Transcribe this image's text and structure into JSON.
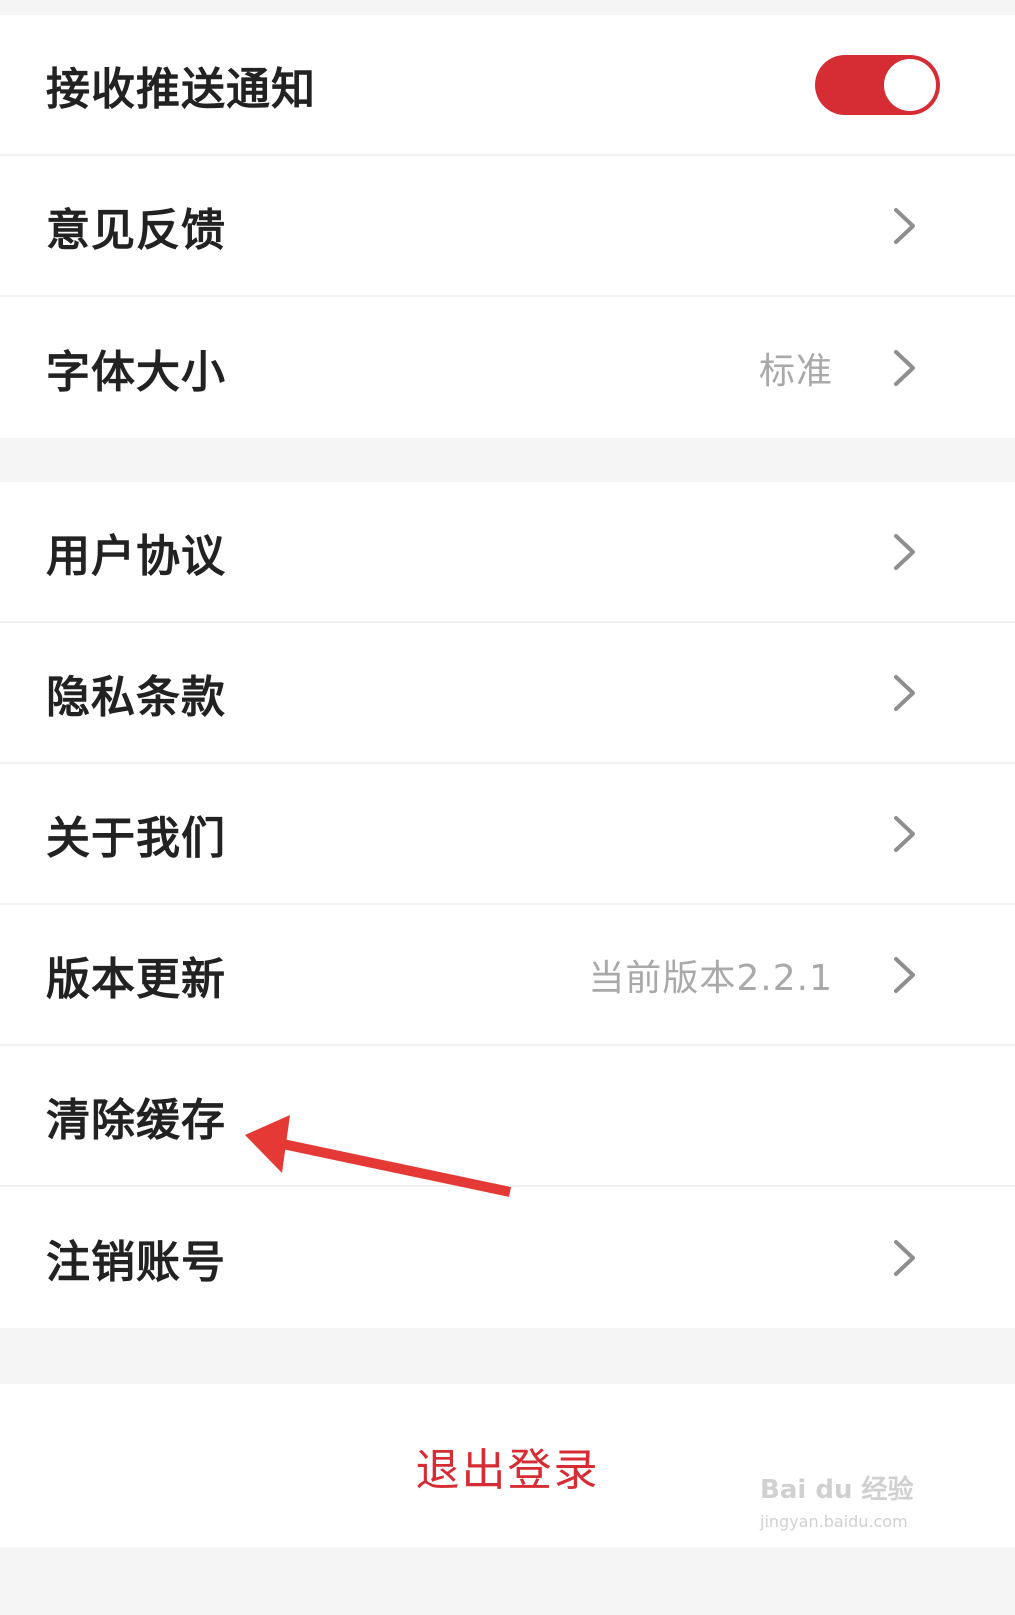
{
  "settings_group_1": [
    {
      "label": "接收推送通知",
      "toggle_on": true
    },
    {
      "label": "意见反馈"
    },
    {
      "label": "字体大小",
      "value": "标准"
    }
  ],
  "settings_group_2": [
    {
      "label": "用户协议"
    },
    {
      "label": "隐私条款"
    },
    {
      "label": "关于我们"
    },
    {
      "label": "版本更新",
      "value": "当前版本2.2.1"
    },
    {
      "label": "清除缓存"
    },
    {
      "label": "注销账号"
    }
  ],
  "logout_label": "退出登录",
  "watermark": {
    "brand": "Bai du 经验",
    "url": "jingyan.baidu.com"
  },
  "colors": {
    "accent": "#d62c34",
    "arrow": "#e53935"
  },
  "icons": [
    "chevron-right-icon",
    "toggle-switch",
    "arrow-annotation-icon"
  ]
}
